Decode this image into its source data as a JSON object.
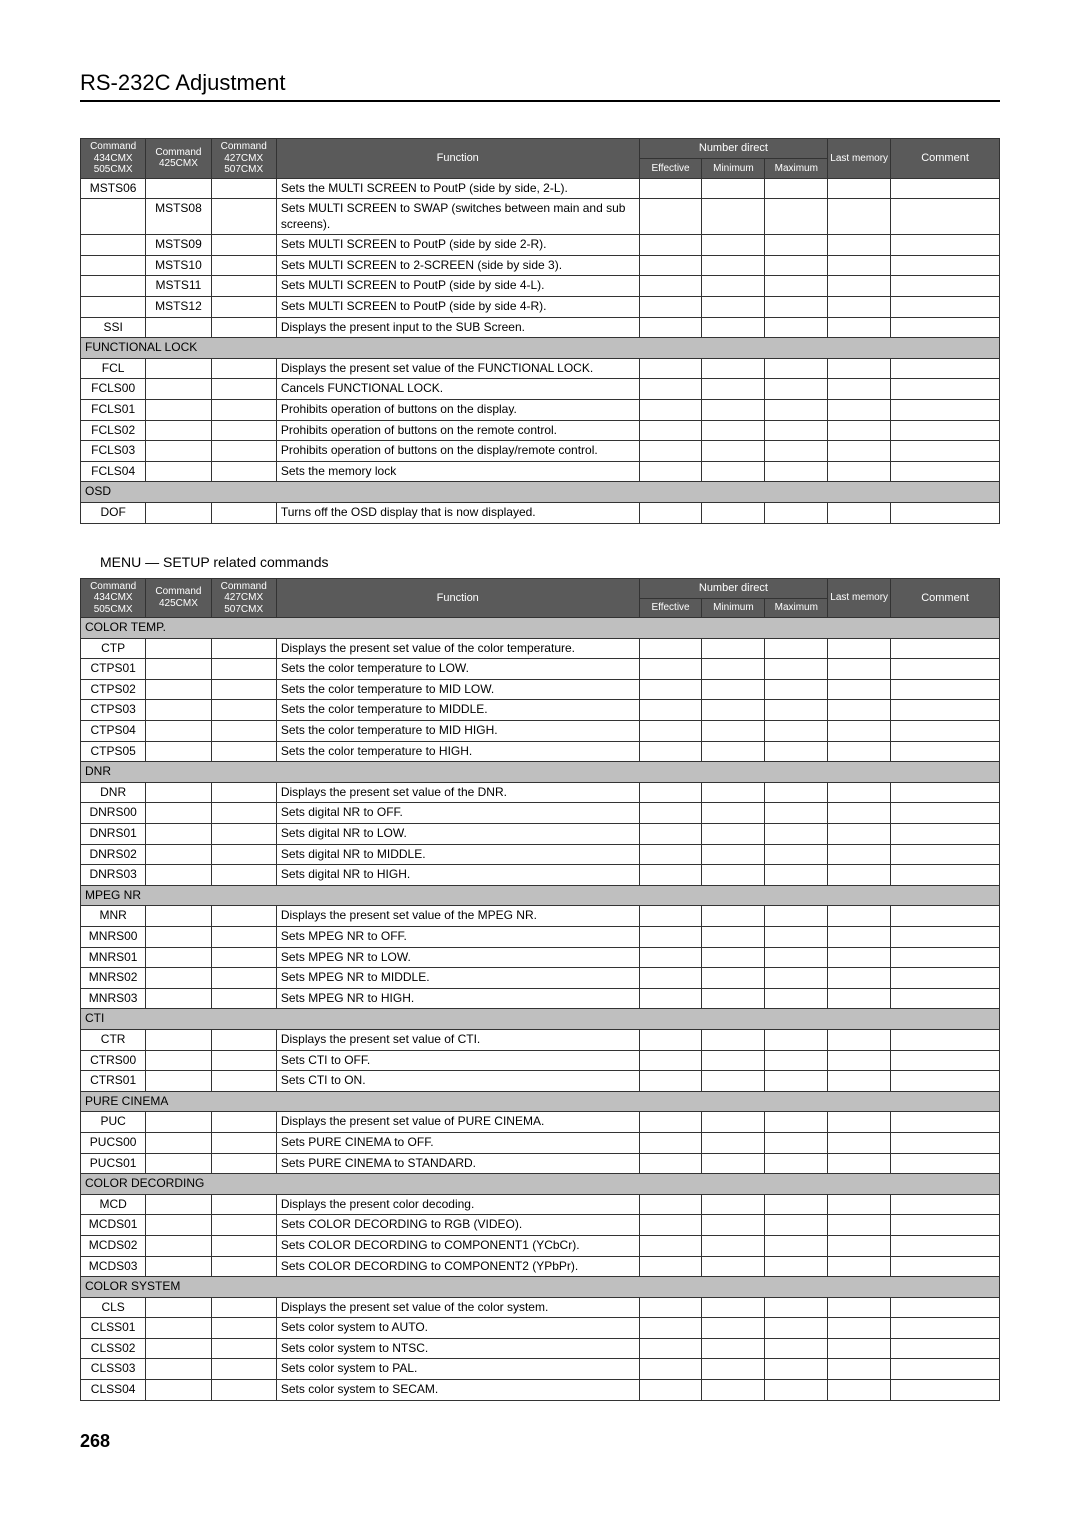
{
  "title": "RS-232C Adjustment",
  "page_num": "268",
  "section2_title": "MENU — SETUP   related commands",
  "headers": {
    "c1a": "Command",
    "c1b": "434CMX",
    "c1c": "505CMX",
    "c2a": "Command",
    "c2b": "425CMX",
    "c3a": "Command",
    "c3b": "427CMX",
    "c3c": "507CMX",
    "fn": "Function",
    "nd": "Number direct",
    "eff": "Effective",
    "min": "Minimum",
    "max": "Maximum",
    "last": "Last memory",
    "comment": "Comment"
  },
  "table1": [
    {
      "type": "row",
      "c1": "MSTS06",
      "c2": "",
      "c3": "",
      "fn": "Sets the MULTI SCREEN to PoutP (side by side, 2-L)."
    },
    {
      "type": "row",
      "c1": "",
      "c2": "MSTS08",
      "c3": "",
      "fn": "Sets MULTI SCREEN to SWAP (switches between main and sub screens)."
    },
    {
      "type": "row",
      "c1": "",
      "c2": "MSTS09",
      "c3": "",
      "fn": "Sets MULTI SCREEN to PoutP (side by side 2-R)."
    },
    {
      "type": "row",
      "c1": "",
      "c2": "MSTS10",
      "c3": "",
      "fn": "Sets MULTI SCREEN to 2-SCREEN (side by side 3)."
    },
    {
      "type": "row",
      "c1": "",
      "c2": "MSTS11",
      "c3": "",
      "fn": "Sets MULTI SCREEN to PoutP (side by side 4-L)."
    },
    {
      "type": "row",
      "c1": "",
      "c2": "MSTS12",
      "c3": "",
      "fn": "Sets MULTI SCREEN to PoutP (side by side 4-R)."
    },
    {
      "type": "row",
      "c1": "SSI",
      "c2": "",
      "c3": "",
      "fn": "Displays the present input to the SUB Screen."
    },
    {
      "type": "section",
      "label": "FUNCTIONAL LOCK"
    },
    {
      "type": "row",
      "c1": "FCL",
      "c2": "",
      "c3": "",
      "fn": "Displays the present set value of the FUNCTIONAL LOCK."
    },
    {
      "type": "row",
      "c1": "FCLS00",
      "c2": "",
      "c3": "",
      "fn": "Cancels FUNCTIONAL LOCK."
    },
    {
      "type": "row",
      "c1": "FCLS01",
      "c2": "",
      "c3": "",
      "fn": "Prohibits operation of buttons on the display."
    },
    {
      "type": "row",
      "c1": "FCLS02",
      "c2": "",
      "c3": "",
      "fn": "Prohibits operation of buttons on the remote control."
    },
    {
      "type": "row",
      "c1": "FCLS03",
      "c2": "",
      "c3": "",
      "fn": "Prohibits operation of buttons on the display/remote control."
    },
    {
      "type": "row",
      "c1": "FCLS04",
      "c2": "",
      "c3": "",
      "fn": "Sets the memory lock"
    },
    {
      "type": "section",
      "label": "OSD"
    },
    {
      "type": "row",
      "c1": "DOF",
      "c2": "",
      "c3": "",
      "fn": "Turns off the OSD display that is now displayed."
    }
  ],
  "table2": [
    {
      "type": "section",
      "label": "COLOR TEMP."
    },
    {
      "type": "row",
      "c1": "CTP",
      "c2": "",
      "c3": "",
      "fn": "Displays the present set value of the color temperature."
    },
    {
      "type": "row",
      "c1": "CTPS01",
      "c2": "",
      "c3": "",
      "fn": "Sets the color temperature to LOW."
    },
    {
      "type": "row",
      "c1": "CTPS02",
      "c2": "",
      "c3": "",
      "fn": "Sets the color temperature to MID LOW."
    },
    {
      "type": "row",
      "c1": "CTPS03",
      "c2": "",
      "c3": "",
      "fn": "Sets the color temperature to MIDDLE."
    },
    {
      "type": "row",
      "c1": "CTPS04",
      "c2": "",
      "c3": "",
      "fn": "Sets the color temperature to MID HIGH."
    },
    {
      "type": "row",
      "c1": "CTPS05",
      "c2": "",
      "c3": "",
      "fn": "Sets the color temperature to HIGH."
    },
    {
      "type": "section",
      "label": "DNR"
    },
    {
      "type": "row",
      "c1": "DNR",
      "c2": "",
      "c3": "",
      "fn": "Displays the present set value of the DNR."
    },
    {
      "type": "row",
      "c1": "DNRS00",
      "c2": "",
      "c3": "",
      "fn": "Sets digital NR to OFF."
    },
    {
      "type": "row",
      "c1": "DNRS01",
      "c2": "",
      "c3": "",
      "fn": "Sets digital NR to LOW."
    },
    {
      "type": "row",
      "c1": "DNRS02",
      "c2": "",
      "c3": "",
      "fn": "Sets digital NR to MIDDLE."
    },
    {
      "type": "row",
      "c1": "DNRS03",
      "c2": "",
      "c3": "",
      "fn": "Sets digital NR to HIGH."
    },
    {
      "type": "section",
      "label": "MPEG NR"
    },
    {
      "type": "row",
      "c1": "MNR",
      "c2": "",
      "c3": "",
      "fn": "Displays the present set value of the MPEG NR."
    },
    {
      "type": "row",
      "c1": "MNRS00",
      "c2": "",
      "c3": "",
      "fn": "Sets MPEG NR to OFF."
    },
    {
      "type": "row",
      "c1": "MNRS01",
      "c2": "",
      "c3": "",
      "fn": "Sets MPEG NR to LOW."
    },
    {
      "type": "row",
      "c1": "MNRS02",
      "c2": "",
      "c3": "",
      "fn": "Sets MPEG NR to MIDDLE."
    },
    {
      "type": "row",
      "c1": "MNRS03",
      "c2": "",
      "c3": "",
      "fn": "Sets MPEG NR to HIGH."
    },
    {
      "type": "section",
      "label": "CTI"
    },
    {
      "type": "row",
      "c1": "CTR",
      "c2": "",
      "c3": "",
      "fn": "Displays the present set value of CTI."
    },
    {
      "type": "row",
      "c1": "CTRS00",
      "c2": "",
      "c3": "",
      "fn": "Sets CTI to OFF."
    },
    {
      "type": "row",
      "c1": "CTRS01",
      "c2": "",
      "c3": "",
      "fn": "Sets CTI to ON."
    },
    {
      "type": "section",
      "label": "PURE CINEMA"
    },
    {
      "type": "row",
      "c1": "PUC",
      "c2": "",
      "c3": "",
      "fn": "Displays the present set value of PURE CINEMA."
    },
    {
      "type": "row",
      "c1": "PUCS00",
      "c2": "",
      "c3": "",
      "fn": "Sets PURE CINEMA to OFF."
    },
    {
      "type": "row",
      "c1": "PUCS01",
      "c2": "",
      "c3": "",
      "fn": "Sets PURE CINEMA to STANDARD."
    },
    {
      "type": "section",
      "label": "COLOR DECORDING"
    },
    {
      "type": "row",
      "c1": "MCD",
      "c2": "",
      "c3": "",
      "fn": "Displays the present color decoding."
    },
    {
      "type": "row",
      "c1": "MCDS01",
      "c2": "",
      "c3": "",
      "fn": "Sets COLOR DECORDING to RGB (VIDEO)."
    },
    {
      "type": "row",
      "c1": "MCDS02",
      "c2": "",
      "c3": "",
      "fn": "Sets COLOR DECORDING to COMPONENT1 (YCbCr)."
    },
    {
      "type": "row",
      "c1": "MCDS03",
      "c2": "",
      "c3": "",
      "fn": "Sets COLOR DECORDING to COMPONENT2 (YPbPr)."
    },
    {
      "type": "section",
      "label": "COLOR SYSTEM"
    },
    {
      "type": "row",
      "c1": "CLS",
      "c2": "",
      "c3": "",
      "fn": "Displays the present set value of the color system."
    },
    {
      "type": "row",
      "c1": "CLSS01",
      "c2": "",
      "c3": "",
      "fn": "Sets color system to AUTO."
    },
    {
      "type": "row",
      "c1": "CLSS02",
      "c2": "",
      "c3": "",
      "fn": "Sets color system to NTSC."
    },
    {
      "type": "row",
      "c1": "CLSS03",
      "c2": "",
      "c3": "",
      "fn": "Sets color system to PAL."
    },
    {
      "type": "row",
      "c1": "CLSS04",
      "c2": "",
      "c3": "",
      "fn": "Sets color system to SECAM."
    }
  ]
}
